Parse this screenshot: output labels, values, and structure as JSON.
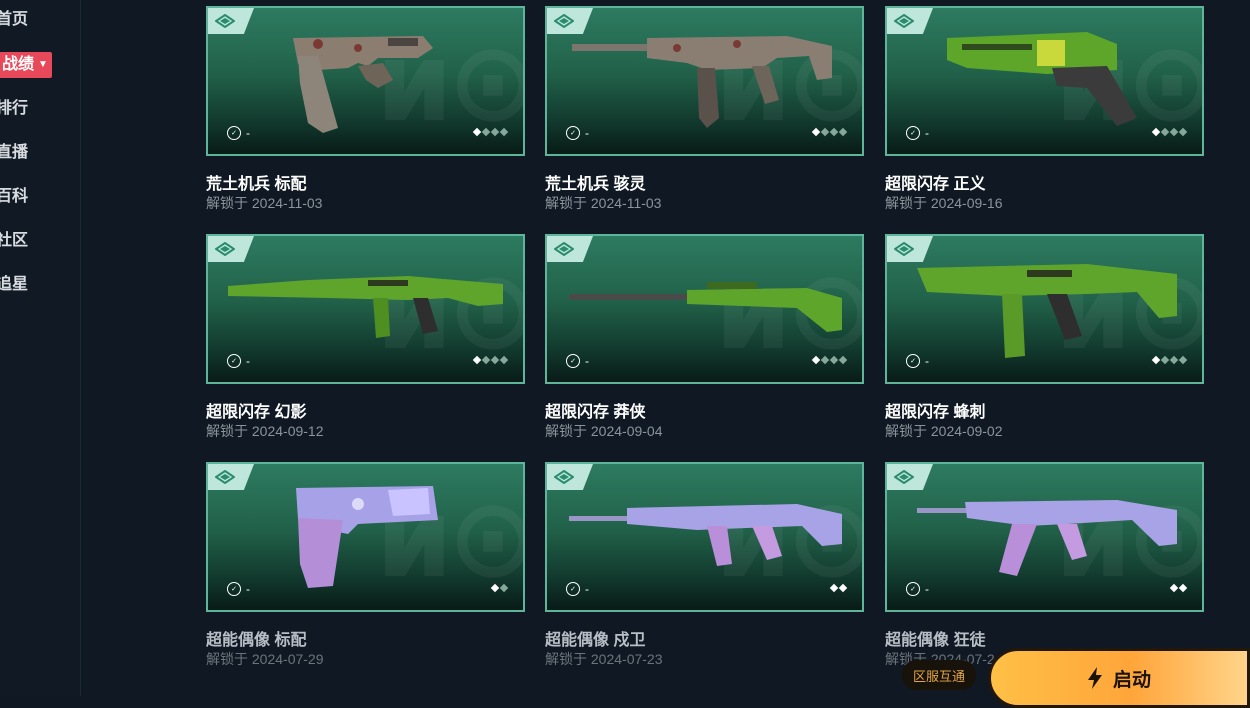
{
  "sidebar": {
    "items": [
      {
        "label": "首页"
      },
      {
        "label": "战绩"
      },
      {
        "label": "排行"
      },
      {
        "label": "直播"
      },
      {
        "label": "百科"
      },
      {
        "label": "社区"
      },
      {
        "label": "追星"
      }
    ],
    "active_index": 1
  },
  "cards": [
    {
      "title": "荒土机兵 标配",
      "subtitle": "解锁于 2024-11-03",
      "tier": "-",
      "levels": 4,
      "level": 1
    },
    {
      "title": "荒土机兵 骇灵",
      "subtitle": "解锁于 2024-11-03",
      "tier": "-",
      "levels": 4,
      "level": 1
    },
    {
      "title": "超限闪存 正义",
      "subtitle": "解锁于 2024-09-16",
      "tier": "-",
      "levels": 4,
      "level": 1
    },
    {
      "title": "超限闪存 幻影",
      "subtitle": "解锁于 2024-09-12",
      "tier": "-",
      "levels": 4,
      "level": 1
    },
    {
      "title": "超限闪存 莽侠",
      "subtitle": "解锁于 2024-09-04",
      "tier": "-",
      "levels": 4,
      "level": 1
    },
    {
      "title": "超限闪存 蜂刺",
      "subtitle": "解锁于 2024-09-02",
      "tier": "-",
      "levels": 4,
      "level": 1
    },
    {
      "title": "超能偶像 标配",
      "subtitle": "解锁于 2024-07-29",
      "tier": "-",
      "levels": 2,
      "level": 1
    },
    {
      "title": "超能偶像 戍卫",
      "subtitle": "解锁于 2024-07-23",
      "tier": "-",
      "levels": 2,
      "level": 2
    },
    {
      "title": "超能偶像 狂徒",
      "subtitle": "解锁于 2024-07-2",
      "tier": "-",
      "levels": 2,
      "level": 2
    }
  ],
  "footer": {
    "region_badge": "区服互通",
    "launch_label": "启动"
  },
  "colors": {
    "accent": "#ffb54a",
    "active_nav": "#e8495a",
    "card_border": "#5fb59a"
  }
}
